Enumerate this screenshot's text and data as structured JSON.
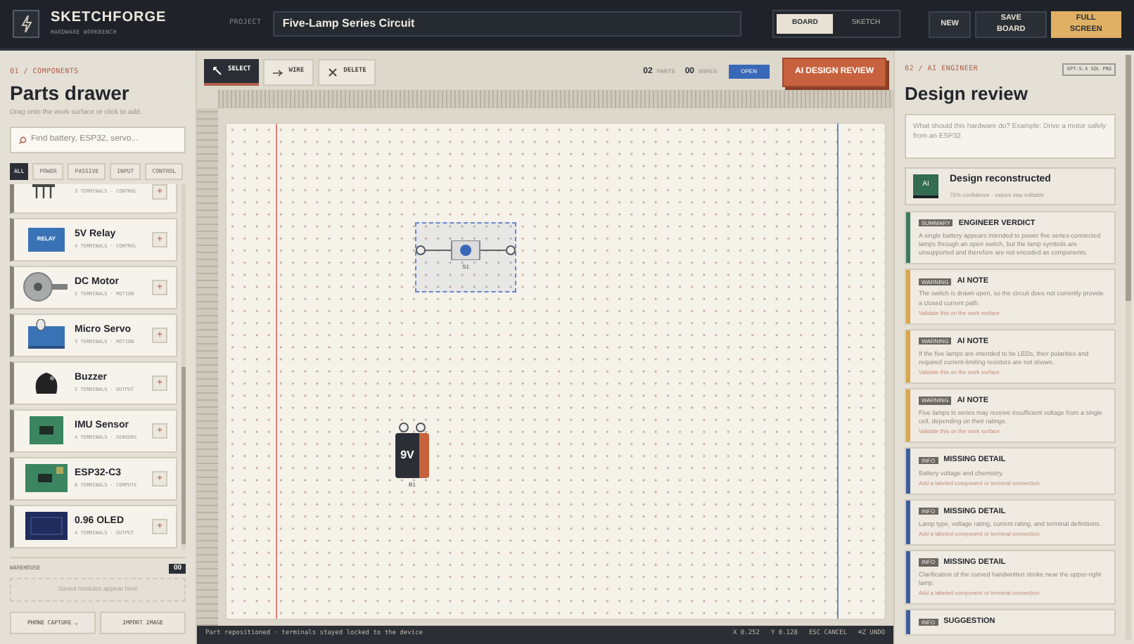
{
  "app": {
    "name": "SKETCHFORGE",
    "subtitle": "HARDWARE WORKBENCH"
  },
  "project": {
    "label": "PROJECT",
    "value": "Five-Lamp Series Circuit"
  },
  "modes": [
    {
      "label": "BOARD",
      "selected": true
    },
    {
      "label": "SKETCH",
      "selected": false
    }
  ],
  "actions": [
    {
      "label": "NEW",
      "kind": "plain"
    },
    {
      "label": "SAVE BOARD",
      "kind": "plain"
    },
    {
      "label": "FULL SCREEN",
      "kind": "accent"
    }
  ],
  "components": {
    "section": "01 / COMPONENTS",
    "title": "Parts drawer",
    "hint": "Drag onto the work surface or click to add.",
    "search_placeholder": "Find battery, ESP32, servo...",
    "filters": [
      {
        "label": "ALL",
        "selected": true
      },
      {
        "label": "POWER",
        "selected": false
      },
      {
        "label": "PASSIVE",
        "selected": false
      },
      {
        "label": "INPUT",
        "selected": false
      },
      {
        "label": "CONTROL",
        "selected": false
      }
    ],
    "parts": [
      {
        "kind": "header",
        "meta": "3 TERMINALS · CONTROL",
        "add": "+"
      },
      {
        "kind": "relay",
        "name": "5V Relay",
        "meta": "4 TERMINALS · CONTROL",
        "add": "+",
        "art": "RELAY"
      },
      {
        "kind": "motor",
        "name": "DC Motor",
        "meta": "2 TERMINALS · MOTION",
        "add": "+"
      },
      {
        "kind": "servo",
        "name": "Micro Servo",
        "meta": "3 TERMINALS · MOTION",
        "add": "+"
      },
      {
        "kind": "buzzer",
        "name": "Buzzer",
        "meta": "2 TERMINALS · OUTPUT",
        "add": "+"
      },
      {
        "kind": "imu",
        "name": "IMU Sensor",
        "meta": "4 TERMINALS · SENSORS",
        "add": "+"
      },
      {
        "kind": "esp",
        "name": "ESP32-C3",
        "meta": "8 TERMINALS · COMPUTE",
        "add": "+"
      },
      {
        "kind": "oled",
        "name": "0.96 OLED",
        "meta": "4 TERMINALS · OUTPUT",
        "add": "+"
      }
    ],
    "warehouse": {
      "label": "WAREHOUSE",
      "count": "00",
      "empty": "Saved modules appear here"
    },
    "buttons": [
      "PHONE CAPTURE ⌄",
      "IMPORT IMAGE"
    ]
  },
  "toolbar": {
    "tools": [
      {
        "label": "SELECT",
        "selected": true
      },
      {
        "label": "WIRE",
        "selected": false
      },
      {
        "label": "DELETE",
        "selected": false
      }
    ],
    "parts_count": "02",
    "parts_label": "PARTS",
    "wires_count": "00",
    "wires_label": "WIRES",
    "status": "OPEN",
    "review": "AI DESIGN REVIEW"
  },
  "canvas": {
    "parts": [
      {
        "kind": "switch",
        "label": "S1",
        "selected": true
      },
      {
        "kind": "battery",
        "label": "B1",
        "text": "9V",
        "selected": false
      }
    ]
  },
  "status_bar": {
    "message": "Part repositioned · terminals stayed locked to the device",
    "items": [
      "X 0.252",
      "Y 0.128",
      "ESC CANCEL",
      "⌘Z UNDO"
    ]
  },
  "engineer": {
    "section": "02 / AI ENGINEER",
    "model": "GPT-5.4 SOL PRO",
    "title": "Design review",
    "prompt_placeholder": "What should this hardware do? Example: Drive a motor safely from an ESP32.",
    "result": {
      "badge": "AI",
      "title": "Design reconstructed",
      "detail": "76% confidence · values stay editable"
    },
    "reviews": [
      {
        "tag": "SUMMARY",
        "title": "ENGINEER VERDICT",
        "color": "#3f7a5e",
        "body": "A single battery appears intended to power five series-connected lamps through an open switch, but the lamp symbols are unsupported and therefore are not encoded as components."
      },
      {
        "tag": "WARNING",
        "title": "AI NOTE",
        "color": "#d9a64a",
        "body": "The switch is drawn open, so the circuit does not currently provide a closed current path.",
        "action": "Validate this on the work surface."
      },
      {
        "tag": "WARNING",
        "title": "AI NOTE",
        "color": "#d9a64a",
        "body": "If the five lamps are intended to be LEDs, their polarities and required current-limiting resistors are not shown.",
        "action": "Validate this on the work surface."
      },
      {
        "tag": "WARNING",
        "title": "AI NOTE",
        "color": "#d9a64a",
        "body": "Five lamps in series may receive insufficient voltage from a single cell, depending on their ratings.",
        "action": "Validate this on the work surface."
      },
      {
        "tag": "INFO",
        "title": "MISSING DETAIL",
        "color": "#3d5f9c",
        "body": "Battery voltage and chemistry.",
        "action": "Add a labeled component or terminal connection."
      },
      {
        "tag": "INFO",
        "title": "MISSING DETAIL",
        "color": "#3d5f9c",
        "body": "Lamp type, voltage rating, current rating, and terminal definitions.",
        "action": "Add a labeled component or terminal connection."
      },
      {
        "tag": "INFO",
        "title": "MISSING DETAIL",
        "color": "#3d5f9c",
        "body": "Clarification of the curved handwritten stroke near the upper-right lamp.",
        "action": "Add a labeled component or terminal connection."
      },
      {
        "tag": "INFO",
        "title": "SUGGESTION",
        "color": "#3d5f9c"
      }
    ]
  }
}
